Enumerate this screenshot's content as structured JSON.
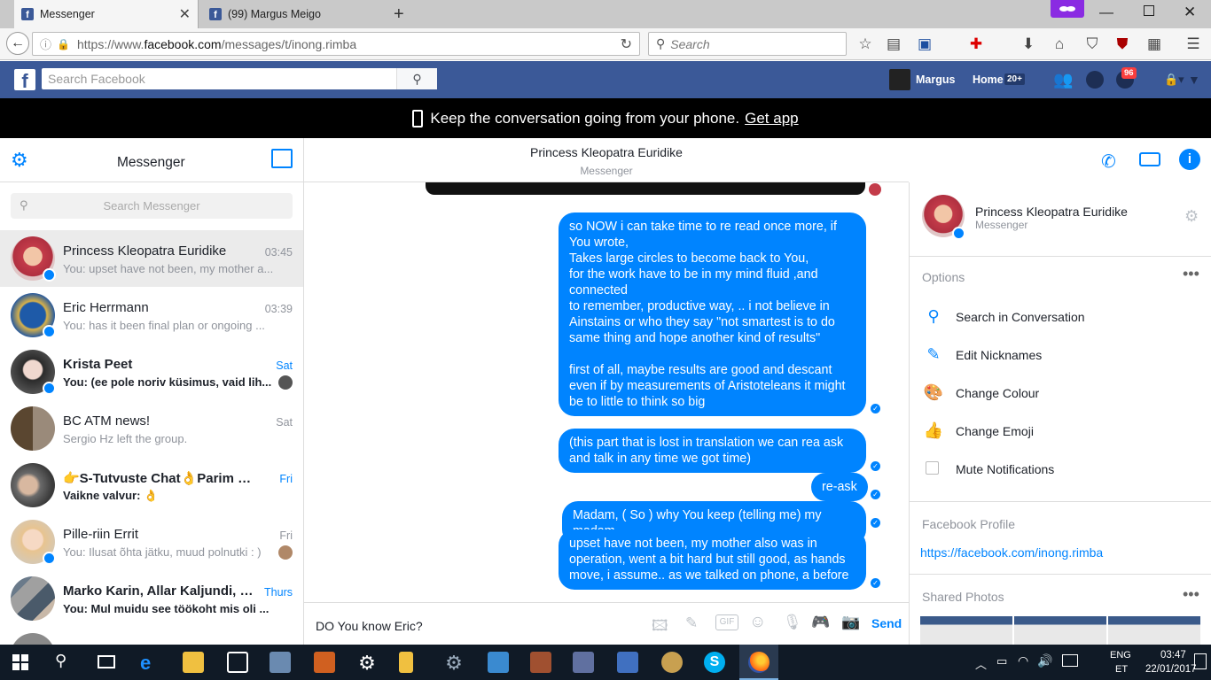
{
  "browser": {
    "tabs": [
      {
        "label": "Messenger",
        "active": true
      },
      {
        "label": "(99) Margus Meigo",
        "active": false
      }
    ],
    "url_prefix": "https://www.",
    "url_host": "facebook.com",
    "url_path": "/messages/t/inong.rimba",
    "search_placeholder": "Search"
  },
  "fb": {
    "search_placeholder": "Search Facebook",
    "user_name": "Margus",
    "home_label": "Home",
    "home_count": "20+",
    "notif_count": "96"
  },
  "banner": {
    "text": "Keep the conversation going from your phone.",
    "link": "Get app"
  },
  "sidebar": {
    "title": "Messenger",
    "search_placeholder": "Search Messenger",
    "conversations": [
      {
        "name": "Princess Kleopatra Euridike",
        "preview": "You: upset have not been, my mother a...",
        "time": "03:45",
        "bold": false
      },
      {
        "name": "Eric Herrmann",
        "preview": "You: has it been final plan or ongoing ...",
        "time": "03:39",
        "bold": false
      },
      {
        "name": "Krista Peet",
        "preview": "You: (ee pole noriv küsimus, vaid lih...",
        "time": "Sat",
        "bold": true
      },
      {
        "name": "BC ATM news!",
        "preview": "Sergio Hz left the group.",
        "time": "Sat",
        "bold": false
      },
      {
        "name": "👉S-Tutvuste Chat👌Parim Ülea...",
        "preview": "Vaikne valvur: 👌",
        "time": "Fri",
        "bold": true
      },
      {
        "name": "Pille-riin Errit",
        "preview": "You: Ilusat õhta jätku, muud polnutki : )",
        "time": "Fri",
        "bold": false
      },
      {
        "name": "Marko Karin, Allar Kaljundi, M...",
        "preview": "You: Mul muidu see töökoht mis oli ...",
        "time": "Thurs",
        "bold": true
      }
    ]
  },
  "chat": {
    "contact_name": "Princess Kleopatra Euridike",
    "contact_sub": "Messenger",
    "messages": [
      {
        "text": "so NOW i can take time to re read once more, if You wrote,\nTakes large circles to become back to You,\nfor the work have to be in my mind fluid ,and connected\nto remember, productive way, .. i not believe in Ainstains or who they say \"not  smartest is to do same thing and hope another kind of results\"\n\nfirst of all, maybe results are good and descant even if by measurements of Aristoteleans it might be to little to think so big"
      },
      {
        "text": "(this part that is lost in translation we can rea ask and talk in any time we got time)"
      },
      {
        "text": "re-ask"
      },
      {
        "text": "Madam, ( So ) why You keep (telling me) my madam"
      },
      {
        "text": "upset have not been, my mother also was in operation, went a bit hard but still good, as hands move, i assume.. as we talked on phone, a before"
      }
    ],
    "composer_value": "DO You know Eric?",
    "send_label": "Send"
  },
  "info": {
    "name": "Princess Kleopatra Euridike",
    "sub": "Messenger",
    "options_label": "Options",
    "options": [
      {
        "label": "Search in Conversation",
        "icon": "search-icon"
      },
      {
        "label": "Edit Nicknames",
        "icon": "pencil-icon"
      },
      {
        "label": "Change Colour",
        "icon": "palette-icon"
      },
      {
        "label": "Change Emoji",
        "icon": "thumbs-up-icon"
      },
      {
        "label": "Mute Notifications",
        "icon": "checkbox-icon"
      }
    ],
    "profile_label": "Facebook Profile",
    "profile_link": "https://facebook.com/inong.rimba",
    "shared_label": "Shared Photos"
  },
  "taskbar": {
    "lang_top": "ENG",
    "lang_bottom": "ET",
    "time": "03:47",
    "date": "22/01/2017"
  },
  "colors": {
    "fb_blue": "#3b5998",
    "messenger_blue": "#0084ff"
  }
}
